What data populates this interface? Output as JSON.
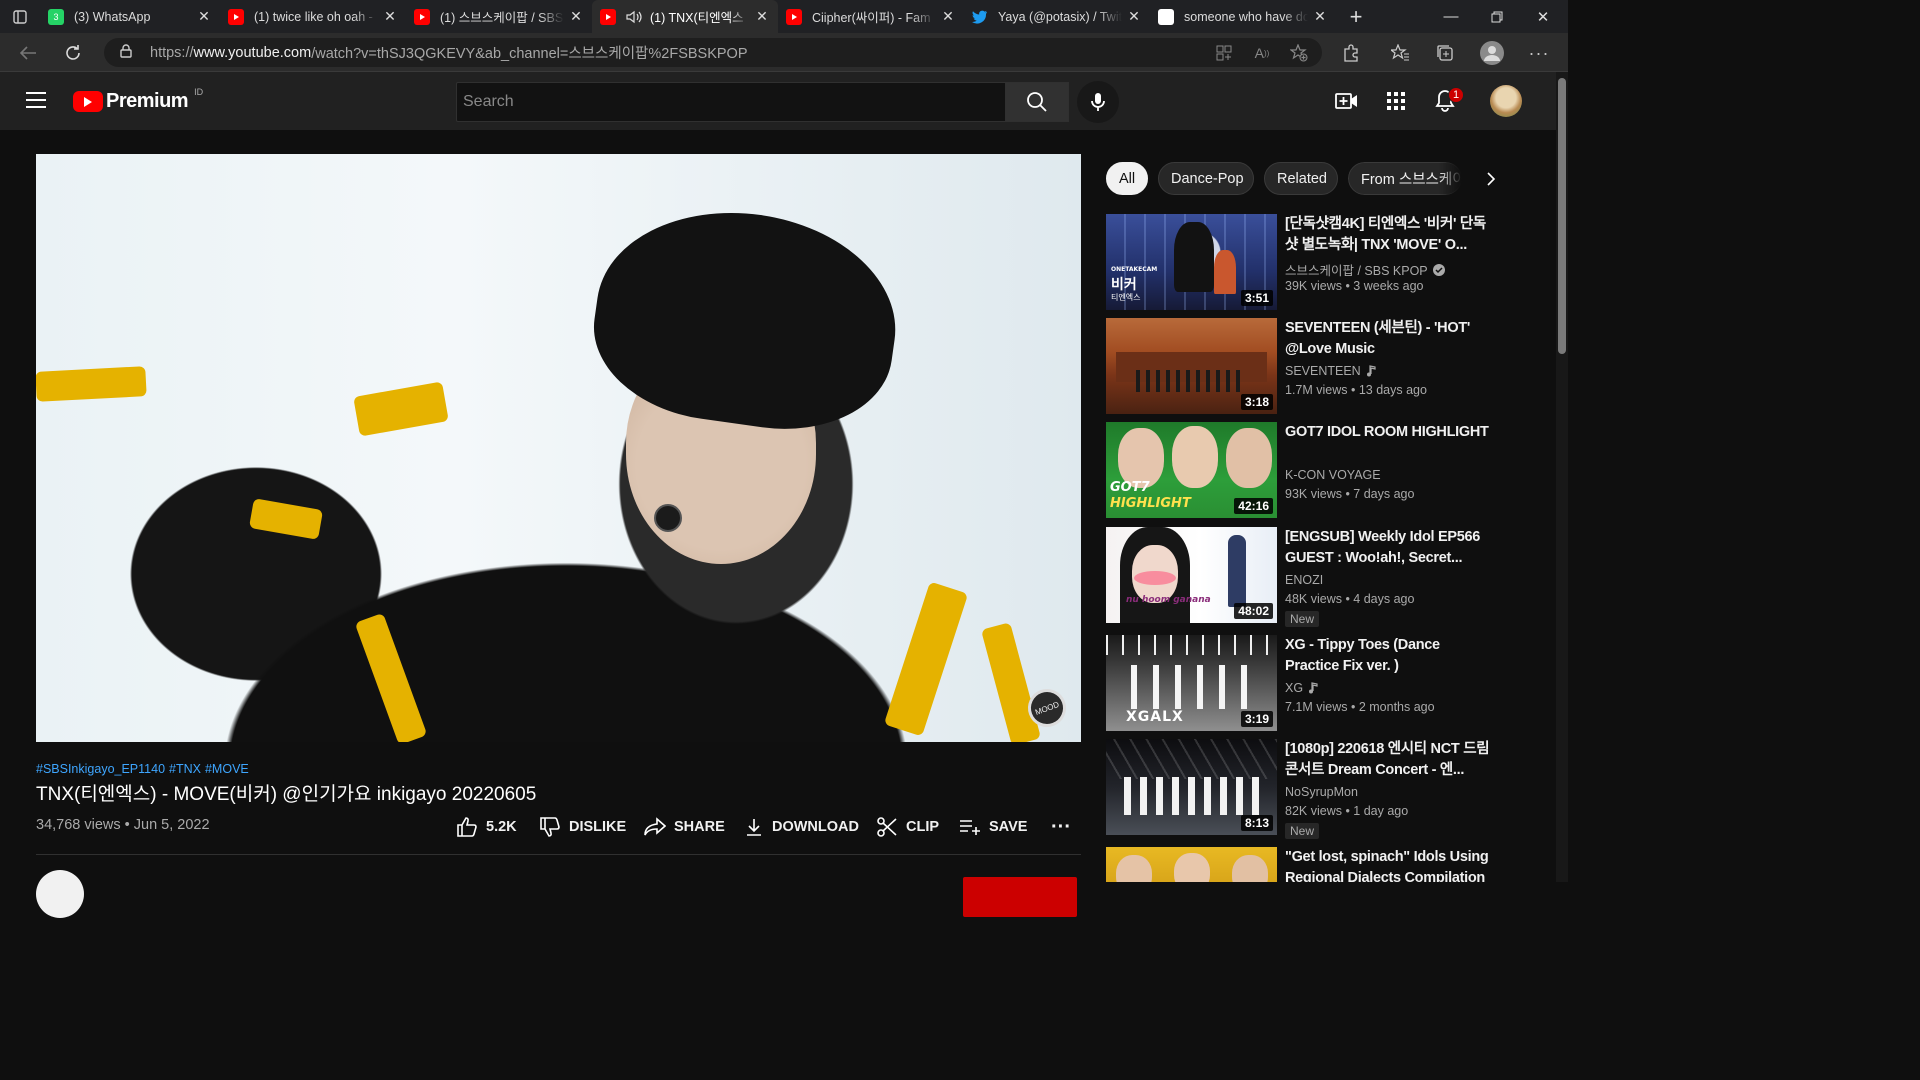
{
  "browser": {
    "tabs": [
      {
        "title": "(3) WhatsApp",
        "favicon": "whatsapp-icon"
      },
      {
        "title": "(1) twice like oh oah -",
        "favicon": "youtube-icon"
      },
      {
        "title": "(1) 스브스케이팝 / SBS",
        "favicon": "youtube-icon"
      },
      {
        "title": "(1) TNX(티엔엑스",
        "favicon": "youtube-icon",
        "active": true
      },
      {
        "title": "Ciipher(싸이퍼) - Fam",
        "favicon": "youtube-icon"
      },
      {
        "title": "Yaya (@potasix) / Twit",
        "favicon": "twitter-icon"
      },
      {
        "title": "someone who have do",
        "favicon": "google-icon"
      }
    ],
    "whatsapp_badge": "3",
    "url_prefix": "https://",
    "url_host": "www.youtube.com",
    "url_path": "/watch?v=thSJ3QGKEVY&ab_channel=스브스케이팝%2FSBSKPOP"
  },
  "youtube": {
    "logo_text": "Premium",
    "country_code": "ID",
    "search_placeholder": "Search",
    "notification_count": "1"
  },
  "video": {
    "hashtags": [
      "#SBSInkigayo_EP1140",
      "#TNX",
      "#MOVE"
    ],
    "title": "TNX(티엔엑스) - MOVE(비커) @인기가요 inkigayo 20220605",
    "views_date": "34,768 views • Jun 5, 2022",
    "actions": {
      "like": "5.2K",
      "dislike": "DISLIKE",
      "share": "SHARE",
      "download": "DOWNLOAD",
      "clip": "CLIP",
      "save": "SAVE"
    },
    "watermark": "MOOD"
  },
  "chips": [
    "All",
    "Dance-Pop",
    "Related",
    "From 스브스케이"
  ],
  "recommendations": [
    {
      "title": "[단독샷캠4K] 티엔엑스 '비커' 단독샷 별도녹화| TNX 'MOVE' O...",
      "channel": "스브스케이팝 / SBS KPOP",
      "badge": "verified",
      "meta": "39K views • 3 weeks ago",
      "duration": "3:51",
      "thumb_text": "비커",
      "thumb_sub": "티엔엑스",
      "thumb_tag": "ONETAKECAM"
    },
    {
      "title": "SEVENTEEN (세븐틴) - 'HOT' @Love Music",
      "channel": "SEVENTEEN",
      "badge": "music",
      "meta": "1.7M views • 13 days ago",
      "duration": "3:18"
    },
    {
      "title": "GOT7 IDOL ROOM HIGHLIGHT",
      "channel": "K-CON VOYAGE",
      "meta": "93K views • 7 days ago",
      "duration": "42:16",
      "thumb_text": "GOT7",
      "thumb_sub": "HIGHLIGHT"
    },
    {
      "title": "[ENGSUB] Weekly Idol EP566 GUEST : Woo!ah!, Secret...",
      "channel": "ENOZI",
      "meta": "48K views • 4 days ago",
      "duration": "48:02",
      "new": "New",
      "thumb_text": "nu hoom ganana"
    },
    {
      "title": "XG - Tippy Toes (Dance Practice Fix ver. )",
      "channel": "XG",
      "badge": "music",
      "meta": "7.1M views • 2 months ago",
      "duration": "3:19",
      "thumb_text": "XGALX"
    },
    {
      "title": "[1080p] 220618 엔시티 NCT 드림콘서트 Dream Concert - 엔...",
      "channel": "NoSyrupMon",
      "meta": "82K views • 1 day ago",
      "duration": "8:13",
      "new": "New"
    },
    {
      "title": "\"Get lost, spinach\" Idols Using Regional Dialects Compilation",
      "channel": "",
      "meta": ""
    }
  ],
  "colors": {
    "accent": "#ff0000",
    "link": "#3ea6ff",
    "bg": "#0f0f0f",
    "stripe": "#e5b200"
  }
}
